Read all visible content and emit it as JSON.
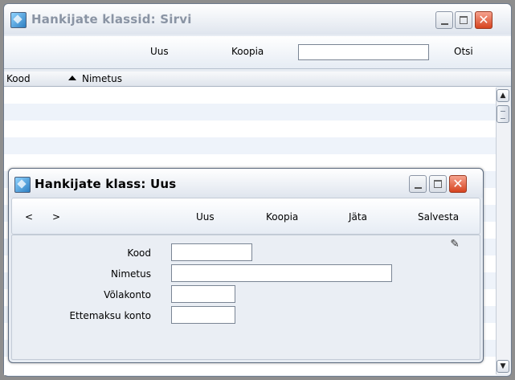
{
  "main_window": {
    "title": "Hankijate klassid: Sirvi",
    "toolbar": {
      "new_label": "Uus",
      "copy_label": "Koopia",
      "search_value": "",
      "search_label": "Otsi"
    },
    "columns": {
      "code": "Kood",
      "name": "Nimetus"
    },
    "rows": []
  },
  "dialog": {
    "title": "Hankijate klass: Uus",
    "toolbar": {
      "prev": "<",
      "next": ">",
      "new_label": "Uus",
      "copy_label": "Koopia",
      "skip_label": "Jäta",
      "save_label": "Salvesta"
    },
    "fields": {
      "code_label": "Kood",
      "code_value": "",
      "name_label": "Nimetus",
      "name_value": "",
      "debt_account_label": "Võlakonto",
      "debt_account_value": "",
      "prepayment_account_label": "Ettemaksu konto",
      "prepayment_account_value": ""
    }
  },
  "icons": {
    "app": "app-window-icon",
    "minimize": "minimize-icon",
    "maximize": "maximize-icon",
    "close": "close-icon",
    "sort": "sort-ascending-icon",
    "pin": "pin-icon",
    "scroll_up": "scroll-up-icon",
    "scroll_down": "scroll-down-icon"
  },
  "colors": {
    "close_button": "#d6431f",
    "title_inactive": "#8a94a4",
    "row_alt": "#eef3fa"
  }
}
